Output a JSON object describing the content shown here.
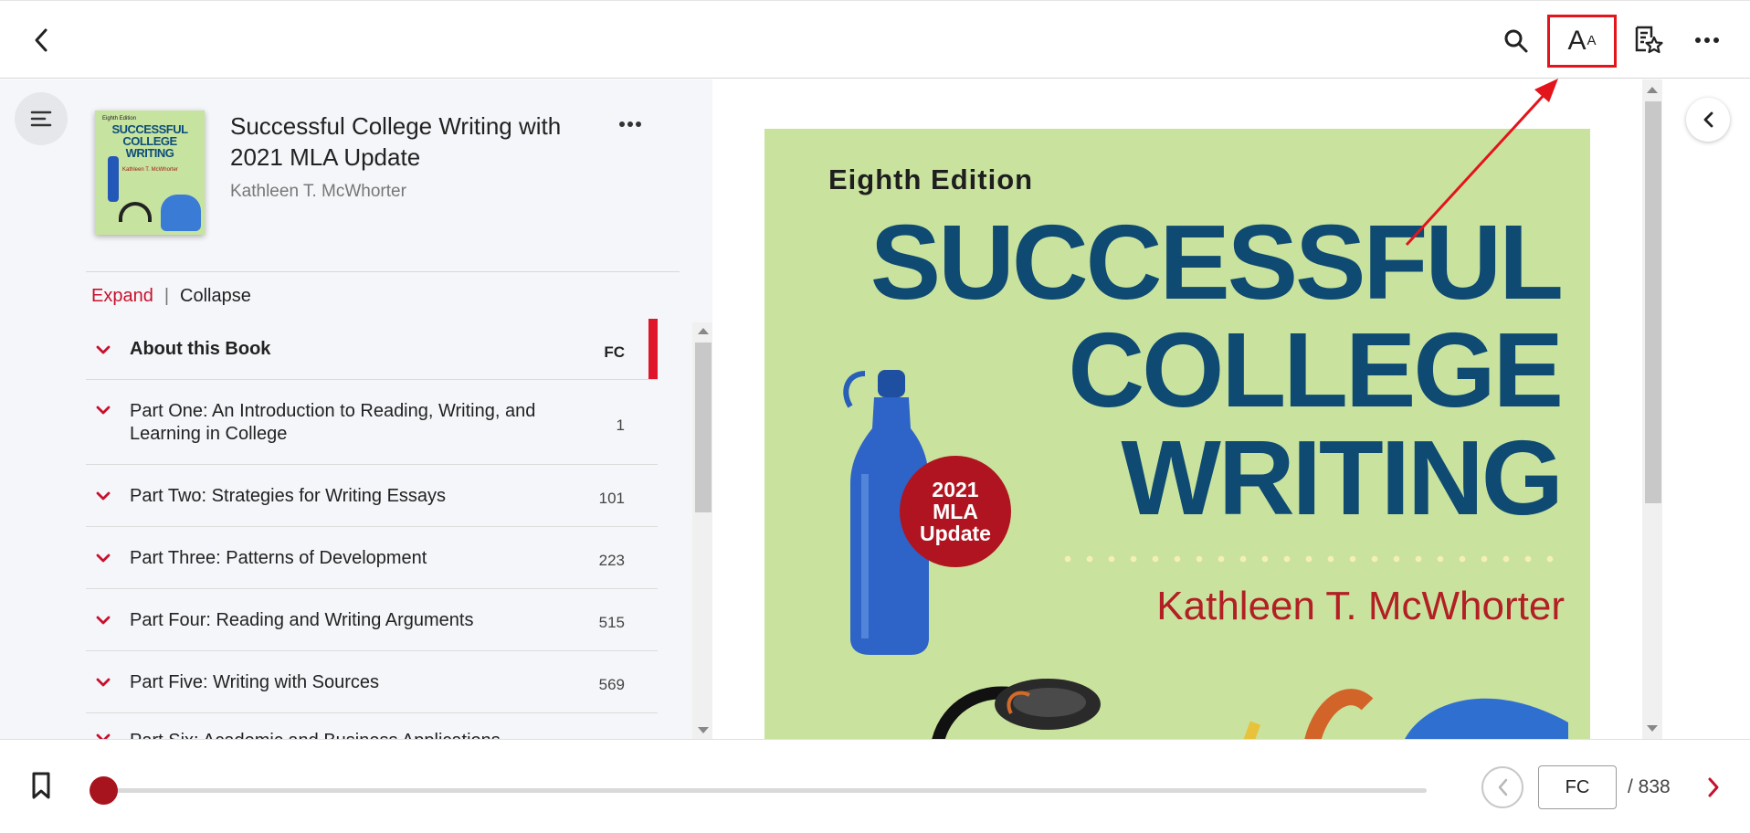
{
  "topbar": {
    "icons": [
      "back-chevron-icon",
      "search-icon",
      "font-size-icon",
      "notes-star-icon",
      "more-horizontal-icon"
    ],
    "font_icon_big": "A",
    "font_icon_small": "A"
  },
  "book": {
    "title": "Successful College Writing with 2021 MLA Update",
    "author": "Kathleen T. McWhorter",
    "thumb_edition": "Eighth Edition",
    "thumb_title": "SUCCESSFUL COLLEGE WRITING",
    "thumb_author": "Kathleen T. McWhorter"
  },
  "toc": {
    "expand_label": "Expand",
    "separator": "|",
    "collapse_label": "Collapse",
    "items": [
      {
        "label": "About this Book",
        "page": "FC"
      },
      {
        "label": "Part One: An Introduction to Reading, Writing, and Learning in College",
        "page": "1"
      },
      {
        "label": "Part Two: Strategies for Writing Essays",
        "page": "101"
      },
      {
        "label": "Part Three: Patterns of Development",
        "page": "223"
      },
      {
        "label": "Part Four: Reading and Writing Arguments",
        "page": "515"
      },
      {
        "label": "Part Five: Writing with Sources",
        "page": "569"
      },
      {
        "label": "Part Six: Academic and Business Applications",
        "page": ""
      }
    ]
  },
  "cover": {
    "edition": "Eighth Edition",
    "title_line1": "SUCCESSFUL",
    "title_line2": "COLLEGE",
    "title_line3": "WRITING",
    "badge_line1": "2021",
    "badge_line2": "MLA",
    "badge_line3": "Update",
    "author": "Kathleen T. McWhorter",
    "background_color": "#c9e39f",
    "title_color": "#0e4a72",
    "author_color": "#b21f24"
  },
  "bottom": {
    "page_input_value": "FC",
    "page_total": "/ 838",
    "progress_fraction": 0.0
  },
  "colors": {
    "accent": "#c8102e",
    "annotation": "#e3141b"
  }
}
